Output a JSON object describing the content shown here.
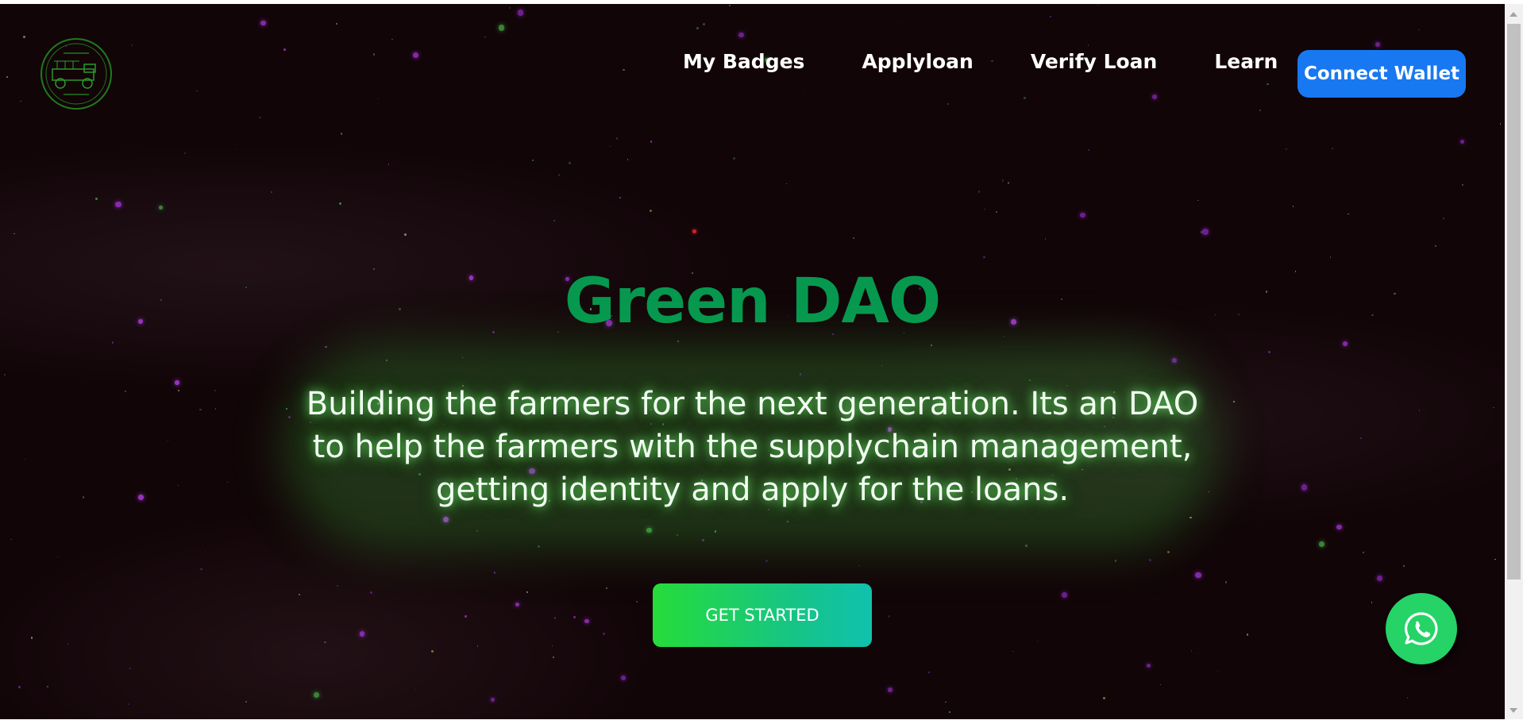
{
  "nav": {
    "logo_alt": "Green DAO logo",
    "links": [
      "My Badges",
      "Applyloan",
      "Verify Loan",
      "Learn"
    ],
    "connect_label": "Connect Wallet"
  },
  "hero": {
    "title": "Green DAO",
    "subtitle_lines": [
      "Building the farmers for the next generation. Its an DAO",
      "to help the farmers with the supplychain management,",
      "getting identity and apply for the loans."
    ],
    "cta_label": "GET STARTED"
  },
  "whatsapp_icon": "whatsapp-icon",
  "colors": {
    "background": "#120508",
    "title_green": "#06984f",
    "connect_blue": "#1778f2",
    "cta_gradient_start": "#26dc3a",
    "cta_gradient_end": "#10c1ae",
    "whatsapp_green": "#25d366"
  }
}
